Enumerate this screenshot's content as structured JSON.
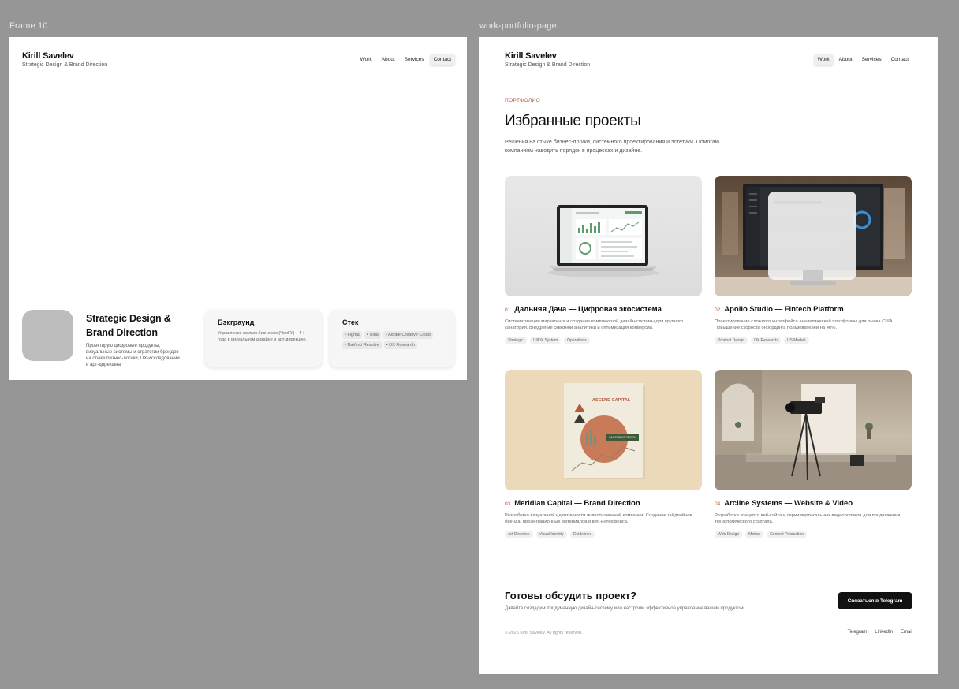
{
  "labels": {
    "frame10": "Frame 10",
    "portfolio": "work-portfolio-page"
  },
  "brand": {
    "name": "Kirill Savelev",
    "subtitle": "Strategic Design & Brand Direction"
  },
  "nav": [
    "Work",
    "About",
    "Services",
    "Contact"
  ],
  "frame10": {
    "active_nav": "Contact",
    "hero_title": "Strategic Design & Brand Direction",
    "hero_desc": "Проектирую цифровые продукты, визуальные системы и стратегии брендов на стыке бизнес-логики, UX-исследований и арт-дирекшна.",
    "background": {
      "title": "Бэкграунд",
      "text": "Управление малым бизнесом (ЧелГУ) + 4+ года в визуальном дизайне и арт-дирекшне."
    },
    "stack": {
      "title": "Стек",
      "chips": [
        "• Figma",
        "• Tilda",
        "• Adobe Creative Cloud",
        "• DaVinci Resolve",
        "• UX Research"
      ]
    }
  },
  "portfolio": {
    "active_nav": "Work",
    "eyebrow": "ПОРТФОЛИО",
    "title": "Избранные проекты",
    "description": "Решения на стыке бизнес-логики, системного проектирования и эстетики. Помогаю компаниям наводить порядок в процессах и дизайне.",
    "projects": [
      {
        "num": "01",
        "title": "Дальняя Дача — Цифровая экосистема",
        "desc": "Систематизация маркетинга и создание комплексной дизайн-системы для крупного санатория. Внедрение сквозной аналитики и оптимизация конверсии.",
        "tags": [
          "Strategic",
          "UI/UX System",
          "Operations"
        ]
      },
      {
        "num": "02",
        "title": "Apollo Studio — Fintech Platform",
        "desc": "Проектирование сложного интерфейса аналитической платформы для рынка США. Повышение скорости онбординга пользователей на 40%.",
        "tags": [
          "Product Design",
          "UX Research",
          "US Market"
        ]
      },
      {
        "num": "03",
        "title": "Meridian Capital — Brand Direction",
        "desc": "Разработка визуальной идентичности инвестиционной компании. Создание гайдлайнов бренда, презентационных материалов и веб-интерфейса.",
        "tags": [
          "Art Direction",
          "Visual Identity",
          "Guidelines"
        ],
        "book_title": "ASCEND CAPITAL",
        "book_badge": "INVESTMENT DESIGN"
      },
      {
        "num": "04",
        "title": "Arcline Systems — Website & Video",
        "desc": "Разработка концепта веб-сайта и серии вертикальных видеороликов для продвижения технологического стартапа.",
        "tags": [
          "Web Design",
          "Motion",
          "Content Production"
        ]
      }
    ],
    "cta": {
      "title": "Готовы обсудить проект?",
      "desc": "Давайте создадим продуманную дизайн-систему или настроим эффективное управление вашим продуктом.",
      "button": "Связаться в Telegram"
    },
    "footer": {
      "copyright": "© 2026 Kirill Savelev. All rights reserved.",
      "links": [
        "Telegram",
        "LinkedIn",
        "Email"
      ]
    }
  },
  "colors": {
    "canvas": "#969696",
    "accent": "#b0603d",
    "cta": "#111111"
  }
}
